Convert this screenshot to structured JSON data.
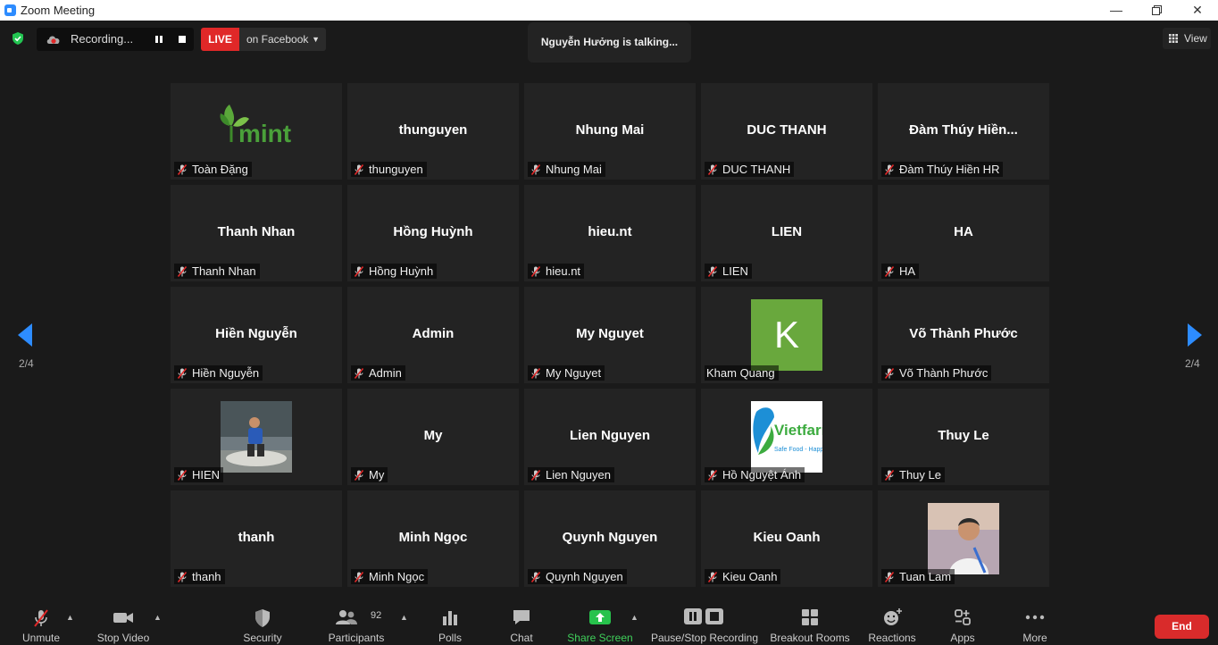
{
  "window": {
    "title": "Zoom Meeting"
  },
  "topbar": {
    "recording_label": "Recording...",
    "live_label": "LIVE",
    "live_target": "on Facebook",
    "talking": "Nguyễn Hưởng is talking...",
    "view_label": "View"
  },
  "nav": {
    "left_page": "2/4",
    "right_page": "2/4"
  },
  "tiles": [
    {
      "big": "",
      "name": "Toàn Đặng",
      "pic": "mint-logo"
    },
    {
      "big": "thunguyen",
      "name": "thunguyen"
    },
    {
      "big": "Nhung Mai",
      "name": "Nhung Mai"
    },
    {
      "big": "DUC THANH",
      "name": "DUC THANH"
    },
    {
      "big": "Đàm Thúy Hiền...",
      "name": "Đàm Thúy Hiền HR"
    },
    {
      "big": "Thanh Nhan",
      "name": "Thanh Nhan"
    },
    {
      "big": "Hồng Huỳnh",
      "name": "Hồng Huỳnh"
    },
    {
      "big": "hieu.nt",
      "name": "hieu.nt"
    },
    {
      "big": "LIEN",
      "name": "LIEN"
    },
    {
      "big": "HA",
      "name": "HA"
    },
    {
      "big": "Hiền Nguyễn",
      "name": "Hiền Nguyễn"
    },
    {
      "big": "Admin",
      "name": "Admin"
    },
    {
      "big": "My Nguyet",
      "name": "My Nguyet"
    },
    {
      "big": "",
      "name": "Kham Quang",
      "avatar_letter": "K"
    },
    {
      "big": "Võ Thành Phước",
      "name": "Võ Thành Phước"
    },
    {
      "big": "",
      "name": "HIEN",
      "pic": "photo"
    },
    {
      "big": "My",
      "name": "My"
    },
    {
      "big": "Lien Nguyen",
      "name": "Lien Nguyen"
    },
    {
      "big": "",
      "name": "Hồ Nguyệt Ánh",
      "pic": "vietfarm-logo"
    },
    {
      "big": "Thuy Le",
      "name": "Thuy Le"
    },
    {
      "big": "thanh",
      "name": "thanh"
    },
    {
      "big": "Minh Ngọc",
      "name": "Minh Ngọc"
    },
    {
      "big": "Quynh Nguyen",
      "name": "Quynh Nguyen"
    },
    {
      "big": "Kieu Oanh",
      "name": "Kieu Oanh"
    },
    {
      "big": "",
      "name": "Tuan Lam",
      "pic": "photo2"
    }
  ],
  "toolbar": {
    "unmute": "Unmute",
    "stop_video": "Stop Video",
    "security": "Security",
    "participants": "Participants",
    "participants_count": "92",
    "polls": "Polls",
    "chat": "Chat",
    "share_screen": "Share Screen",
    "pause_stop_recording": "Pause/Stop Recording",
    "breakout_rooms": "Breakout Rooms",
    "reactions": "Reactions",
    "apps": "Apps",
    "more": "More",
    "end": "End"
  },
  "colors": {
    "accent": "#2d8cff",
    "live": "#e02828",
    "share": "#27c24c",
    "end": "#d92b2b",
    "avatar_k": "#69a83d"
  }
}
